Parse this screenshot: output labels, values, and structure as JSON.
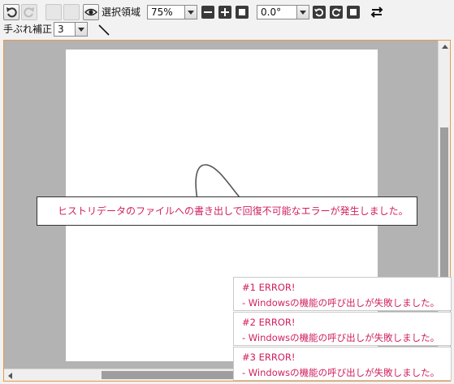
{
  "toolbar": {
    "undo_icon": "undo-icon",
    "redo_icon": "redo-icon",
    "eye_icon": "eye-icon",
    "selection_label": "選択領域",
    "zoom_value": "75%",
    "rotation_value": "0.0°",
    "stabilizer_label": "手ぶれ補正",
    "stabilizer_value": "3"
  },
  "history_error": "ヒストリデータのファイルへの書き出しで回復不可能なエラーが発生しました。",
  "error_toasts": [
    {
      "title": "#1 ERROR!",
      "message": " - Windowsの機能の呼び出しが失敗しました。"
    },
    {
      "title": "#2 ERROR!",
      "message": " - Windowsの機能の呼び出しが失敗しました。"
    },
    {
      "title": "#3 ERROR!",
      "message": " - Windowsの機能の呼び出しが失敗しました。"
    }
  ],
  "colors": {
    "accent_border": "#e69a4a",
    "error_text": "#d02060",
    "canvas_bg": "#b3b3b3"
  }
}
